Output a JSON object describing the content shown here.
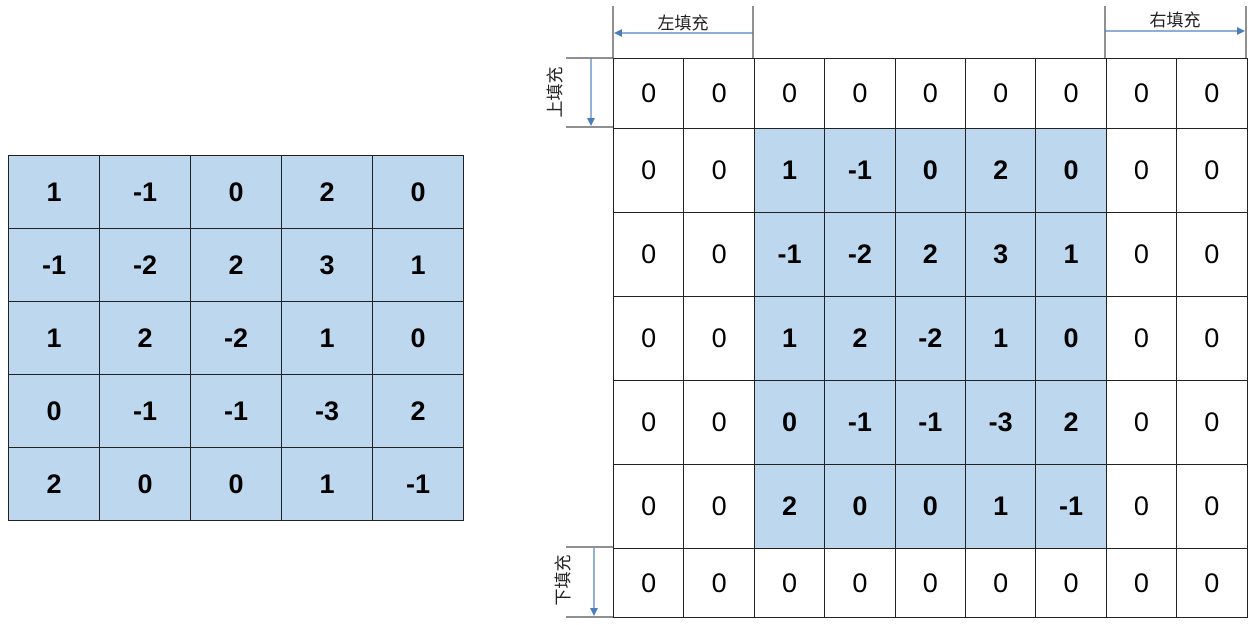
{
  "input_matrix": {
    "rows": [
      [
        "1",
        "-1",
        "0",
        "2",
        "0"
      ],
      [
        "-1",
        "-2",
        "2",
        "3",
        "1"
      ],
      [
        "1",
        "2",
        "-2",
        "1",
        "0"
      ],
      [
        "0",
        "-1",
        "-1",
        "-3",
        "2"
      ],
      [
        "2",
        "0",
        "0",
        "1",
        "-1"
      ]
    ]
  },
  "padded_matrix": {
    "rows": [
      [
        "0",
        "0",
        "0",
        "0",
        "0",
        "0",
        "0",
        "0",
        "0"
      ],
      [
        "0",
        "0",
        "1",
        "-1",
        "0",
        "2",
        "0",
        "0",
        "0"
      ],
      [
        "0",
        "0",
        "-1",
        "-2",
        "2",
        "3",
        "1",
        "0",
        "0"
      ],
      [
        "0",
        "0",
        "1",
        "2",
        "-2",
        "1",
        "0",
        "0",
        "0"
      ],
      [
        "0",
        "0",
        "0",
        "-1",
        "-1",
        "-3",
        "2",
        "0",
        "0"
      ],
      [
        "0",
        "0",
        "2",
        "0",
        "0",
        "1",
        "-1",
        "0",
        "0"
      ],
      [
        "0",
        "0",
        "0",
        "0",
        "0",
        "0",
        "0",
        "0",
        "0"
      ]
    ],
    "original_rows": [
      1,
      2,
      3,
      4,
      5
    ],
    "original_cols": [
      2,
      3,
      4,
      5,
      6
    ]
  },
  "labels": {
    "left_padding": "左填充",
    "right_padding": "右填充",
    "top_padding": "上填充",
    "bottom_padding": "下填充"
  },
  "colors": {
    "highlight_fill": "#bdd7ee",
    "arrow": "#4a7ebb",
    "grid_line": "#222222"
  }
}
